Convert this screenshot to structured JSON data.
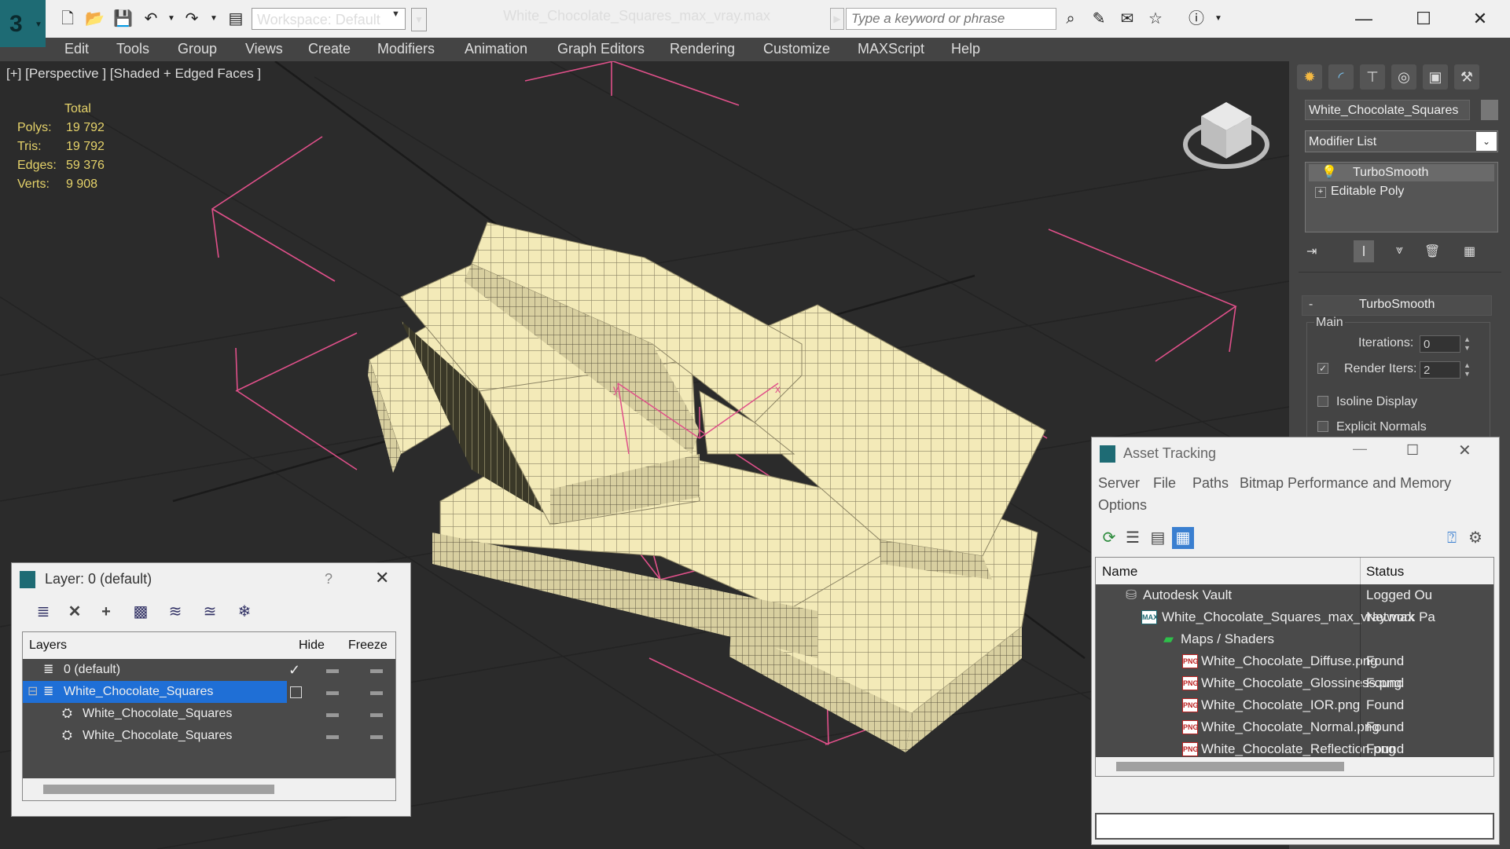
{
  "titlebar": {
    "workspace": "Workspace: Default",
    "doc_title": "White_Chocolate_Squares_max_vray.max",
    "search_placeholder": "Type a keyword or phrase"
  },
  "menu": [
    "Edit",
    "Tools",
    "Group",
    "Views",
    "Create",
    "Modifiers",
    "Animation",
    "Graph Editors",
    "Rendering",
    "Customize",
    "MAXScript",
    "Help"
  ],
  "viewport": {
    "label": "[+] [Perspective ] [Shaded + Edged Faces ]",
    "stats_header": "Total",
    "stats": [
      {
        "label": "Polys:",
        "value": "19 792"
      },
      {
        "label": "Tris:",
        "value": "19 792"
      },
      {
        "label": "Edges:",
        "value": "59 376"
      },
      {
        "label": "Verts:",
        "value": "9 908"
      }
    ],
    "axis_y": "y",
    "axis_x": "x"
  },
  "cmdpanel": {
    "object_name": "White_Chocolate_Squares",
    "modifier_list": "Modifier List",
    "stack": [
      "TurboSmooth",
      "Editable Poly"
    ],
    "rollout_title": "TurboSmooth",
    "rollout_minus": "-",
    "group_main": "Main",
    "iterations_label": "Iterations:",
    "iterations_value": "0",
    "render_iters_label": "Render Iters:",
    "render_iters_value": "2",
    "isoline": "Isoline Display",
    "explicit": "Explicit Normals"
  },
  "layer": {
    "title": "Layer: 0 (default)",
    "help": "?",
    "col_layers": "Layers",
    "col_hide": "Hide",
    "col_freeze": "Freeze",
    "rows": [
      "0 (default)",
      "White_Chocolate_Squares",
      "White_Chocolate_Squares",
      "White_Chocolate_Squares"
    ]
  },
  "asset": {
    "title": "Asset Tracking",
    "menus": [
      "Server",
      "File",
      "Paths",
      "Bitmap Performance and Memory"
    ],
    "menu_options": "Options",
    "col_name": "Name",
    "col_status": "Status",
    "rows": [
      {
        "name": "Autodesk Vault",
        "status": "Logged Ou"
      },
      {
        "name": "White_Chocolate_Squares_max_vray.max",
        "status": "Network Pa"
      },
      {
        "name": "Maps / Shaders",
        "status": ""
      },
      {
        "name": "White_Chocolate_Diffuse.png",
        "status": "Found"
      },
      {
        "name": "White_Chocolate_Glossiness.png",
        "status": "Found"
      },
      {
        "name": "White_Chocolate_IOR.png",
        "status": "Found"
      },
      {
        "name": "White_Chocolate_Normal.png",
        "status": "Found"
      },
      {
        "name": "White_Chocolate_Reflection.png",
        "status": "Found"
      }
    ],
    "png_badge": "PNG",
    "max_badge": "MAX"
  },
  "colors": {
    "selection": "#1f6fd6",
    "wire": "#f3eab8",
    "stat_text": "#e6d36a",
    "gizmo": "#e0508a"
  }
}
